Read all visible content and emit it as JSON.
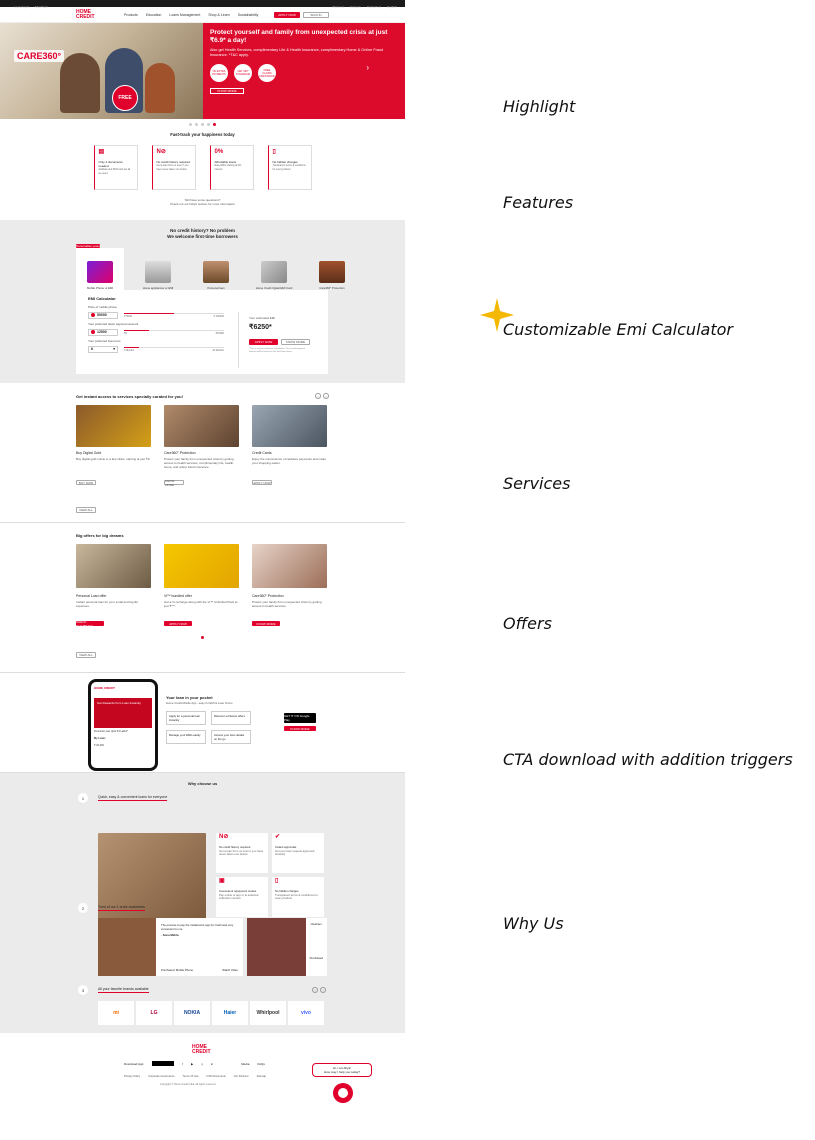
{
  "topbar": {
    "left": [
      "Loan Agent",
      "Merchant"
    ],
    "right": [
      "About us",
      "Careers",
      "Contact us",
      "English"
    ]
  },
  "nav": {
    "logo": "HOME CREDIT",
    "items": [
      "Products",
      "Education",
      "Loans Management",
      "Shop & Learn",
      "Sustainability"
    ],
    "apply": "APPLY NOW",
    "login": "SIGN IN"
  },
  "hero": {
    "brand": "CARE360°",
    "title": "Protect yourself and family from unexpected crisis at just ₹6.9* a day!",
    "text": "Also get Health Services, complimentary Life & Health Insurance, complimentary Home & Online Fraud Insurance. *T&C apply.",
    "free": "FREE",
    "icons": [
      "NO EXTRA PAYMENTS",
      "GET 360° COVERAGE",
      "FREE CLAIMS ASSISTANCE"
    ],
    "cta": "KNOW MORE"
  },
  "features": {
    "title": "Fast-track your happiness today",
    "items": [
      {
        "icon": "doc-icon",
        "title": "Only 2 documents needed",
        "desc": "Aadhaar and PAN card are all we need"
      },
      {
        "icon": "no-history-icon",
        "title": "No credit history required",
        "desc": "Get a loan from us even if you have never taken one before"
      },
      {
        "icon": "percent-icon",
        "title": "Affordable loans",
        "desc": "Easy EMIs starting at 0% interest"
      },
      {
        "icon": "no-hidden-icon",
        "title": "No hidden charges",
        "desc": "Transparent terms & conditions for every product"
      }
    ],
    "note1": "Still have some questions?",
    "note2": "Check out our FAQs section for more information"
  },
  "emi": {
    "title1": "No credit history? No problem",
    "title2": "We welcome first-time borrowers",
    "tabs": [
      "Mobile Phone or EMI",
      "Home appliances or EMI",
      "Personal loan",
      "Home Credit Ujjwal EMI Card",
      "Care360° Protection"
    ],
    "badge": "Personalise yours",
    "calc_title": "EMI Calculator",
    "price_label": "Price of mobile phone",
    "price": "50000",
    "price_min": "₹ 5000",
    "price_max": "₹ 100000",
    "down_label": "Your preferred down payment amount",
    "down": "12500",
    "down_min": "₹0",
    "down_max": "₹15000",
    "tenure_label": "Your preferred loan term",
    "tenure": "6",
    "tenure_min": "3 Months",
    "tenure_max": "24 Months",
    "emi_label": "Your estimated EMI",
    "emi_value": "₹6250*",
    "apply": "APPLY NOW",
    "know": "KNOW MORE",
    "fine": "*This is only an indicative calculation. The actual payment amount will be based on the final loan terms."
  },
  "services": {
    "title": "Get instant access to services specially curated for you!",
    "items": [
      {
        "title": "Buy Digital Gold",
        "desc": "Buy digital gold online in a few clicks, starting at just ₹1!",
        "btn": "BUY NOW"
      },
      {
        "title": "Care360° Protection",
        "desc": "Protect your family from unexpected crisis by getting access to health services, complimentary life, health, home, and online fraud insurance.",
        "btn": "KNOW MORE"
      },
      {
        "title": "Credit Cards",
        "desc": "Enjoy the convenience of cashless payments and make your shopping easier.",
        "btn": "APPLY NOW"
      }
    ],
    "view_all": "VIEW ALL"
  },
  "offers": {
    "title": "Big offers for big dreams",
    "items": [
      {
        "title": "Personal Loan offer",
        "desc": "Instant personal loan for your small and big life expenses.",
        "btn": "CHECK ELIGIBILITY"
      },
      {
        "title": "Vi™ bundled offer",
        "desc": "Get a Vi recharge along with the Vi™ Unlimited Pack at just ₹***.",
        "btn": "APPLY NOW"
      },
      {
        "title": "Care360° Protection",
        "desc": "Protect your family from unexpected crisis by getting access to health services.",
        "btn": "KNOW MORE"
      }
    ],
    "view_all": "VIEW ALL"
  },
  "app": {
    "title": "Your loan in your pocket",
    "sub": "Home Credit Mobile App - easy for EMI & Loan Terms",
    "grid": [
      "Apply for a personal loan instantly",
      "Discover exclusive offers",
      "Manage your EMIs easily",
      "Access your loan details on the go"
    ],
    "store": "GET IT ON Google Play",
    "cta": "KNOW MORE",
    "phone_banner": "Get Rewards from Loan Instantly",
    "phone_lines": [
      "Personal Loan Upto ₹4 Lakhs*",
      "My Loans"
    ],
    "phone_amount": "₹ 20,000"
  },
  "why": {
    "title": "Why choose us",
    "s1": "Quick, easy & convenient loans for everyone",
    "f": [
      {
        "icon": "no-history-icon",
        "title": "No credit history required",
        "desc": "Get a loan from us even if you have never taken one before"
      },
      {
        "icon": "check-icon",
        "title": "Instant approvals",
        "desc": "Get your loan request approved instantly"
      },
      {
        "icon": "calendar-icon",
        "title": "Convenient repayment modes",
        "desc": "Pay online or app or at selected collection centres"
      },
      {
        "icon": "no-hidden-icon",
        "title": "No hidden charges",
        "desc": "Transparent terms & conditions for every product"
      }
    ],
    "s2": "Trust of our 1 crore customers",
    "test_quote": "The process to pay the instalments app for credit was very convenient to me.",
    "test_name": "- Sonu Mehta",
    "test_product": "Purchased: Mobile Phone",
    "watch": "Watch Video",
    "test2_name": "- Resham",
    "test2_product": "Purchased",
    "s3": "All your favorite brands available",
    "brands": [
      "mi",
      "LG",
      "NOKIA",
      "Haier",
      "Whirlpool",
      "vivo"
    ]
  },
  "footer": {
    "logo": "HOME CREDIT",
    "download": "Download App:",
    "social": [
      "f",
      "▶",
      "y",
      "in"
    ],
    "lang": [
      "Media",
      "FAQs"
    ],
    "links": [
      "Privacy Policy",
      "Corporate Governance",
      "Terms Of Use",
      "CSR Documents",
      "Our Partners",
      "Sitemap"
    ],
    "copyright": "Copyright © Home Credit India. All rights reserved.",
    "chat1": "Hi, I am Riya!",
    "chat2": "How may I help you today?"
  },
  "annotations": [
    "Highlight",
    "Features",
    "Customizable Emi Calculator",
    "Services",
    "Offers",
    "CTA download with addition triggers",
    "Why Us"
  ],
  "colors": {
    "brand": "#e0002b",
    "section_bg": "#ebebeb"
  }
}
